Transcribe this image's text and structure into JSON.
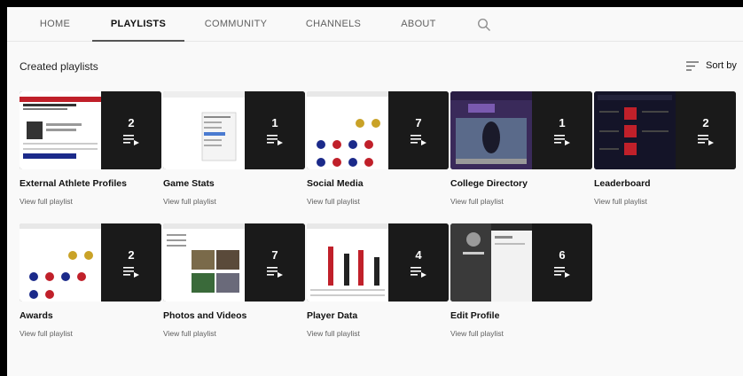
{
  "tabs": [
    "HOME",
    "PLAYLISTS",
    "COMMUNITY",
    "CHANNELS",
    "ABOUT"
  ],
  "active_tab": "PLAYLISTS",
  "section": {
    "title": "Created playlists",
    "sort_label": "Sort by"
  },
  "playlists": [
    {
      "title": "External Athlete Profiles",
      "count": "2",
      "link": "View full playlist",
      "thumb": "profile-page"
    },
    {
      "title": "Game Stats",
      "count": "1",
      "link": "View full playlist",
      "thumb": "stats-table"
    },
    {
      "title": "Social Media",
      "count": "7",
      "link": "View full playlist",
      "thumb": "badge-grid"
    },
    {
      "title": "College Directory",
      "count": "1",
      "link": "View full playlist",
      "thumb": "college-photo"
    },
    {
      "title": "Leaderboard",
      "count": "2",
      "link": "View full playlist",
      "thumb": "dark-leaderboard"
    },
    {
      "title": "Awards",
      "count": "2",
      "link": "View full playlist",
      "thumb": "badge-grid"
    },
    {
      "title": "Photos and Videos",
      "count": "7",
      "link": "View full playlist",
      "thumb": "photo-gallery"
    },
    {
      "title": "Player Data",
      "count": "4",
      "link": "View full playlist",
      "thumb": "bar-data"
    },
    {
      "title": "Edit Profile",
      "count": "6",
      "link": "View full playlist",
      "thumb": "edit-profile"
    }
  ],
  "colors": {
    "background": "#f9f9f9",
    "outer": "#000000",
    "overlay": "#191919",
    "accent_red": "#c0202a"
  },
  "icons": {
    "search": "search-icon",
    "sort": "sort-icon",
    "playlist": "playlist-icon"
  }
}
